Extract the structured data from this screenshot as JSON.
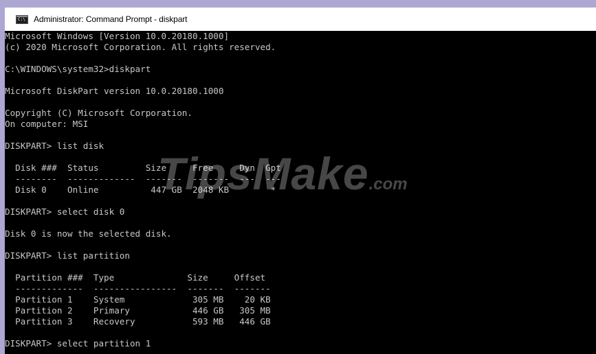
{
  "window": {
    "title": "Administrator: Command Prompt - diskpart",
    "icon": "cmd-icon",
    "icon_glyph": "C:\\"
  },
  "console": {
    "lines": [
      "Microsoft Windows [Version 10.0.20180.1000]",
      "(c) 2020 Microsoft Corporation. All rights reserved.",
      "",
      "C:\\WINDOWS\\system32>diskpart",
      "",
      "Microsoft DiskPart version 10.0.20180.1000",
      "",
      "Copyright (C) Microsoft Corporation.",
      "On computer: MSI",
      "",
      "DISKPART> list disk",
      "",
      "  Disk ###  Status         Size     Free     Dyn  Gpt",
      "  --------  -------------  -------  -------  ---  ---",
      "  Disk 0    Online          447 GB  2048 KB        *",
      "",
      "DISKPART> select disk 0",
      "",
      "Disk 0 is now the selected disk.",
      "",
      "DISKPART> list partition",
      "",
      "  Partition ###  Type              Size     Offset",
      "  -------------  ----------------  -------  -------",
      "  Partition 1    System             305 MB    20 KB",
      "  Partition 2    Primary            446 GB   305 MB",
      "  Partition 3    Recovery           593 MB   446 GB",
      "",
      "DISKPART> select partition 1"
    ]
  },
  "watermark": {
    "text": "TipsMake",
    "suffix": ".com"
  }
}
